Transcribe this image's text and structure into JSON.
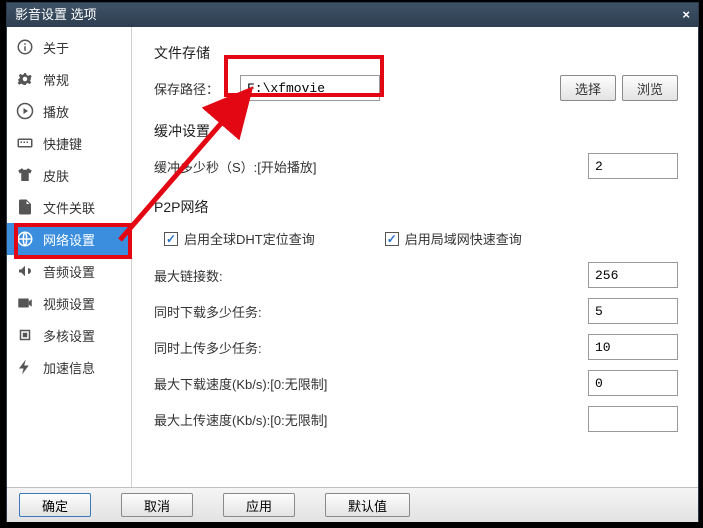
{
  "window": {
    "title": "影音设置 选项"
  },
  "sidebar": {
    "items": [
      {
        "label": "关于"
      },
      {
        "label": "常规"
      },
      {
        "label": "播放"
      },
      {
        "label": "快捷键"
      },
      {
        "label": "皮肤"
      },
      {
        "label": "文件关联"
      },
      {
        "label": "网络设置"
      },
      {
        "label": "音频设置"
      },
      {
        "label": "视频设置"
      },
      {
        "label": "多核设置"
      },
      {
        "label": "加速信息"
      }
    ],
    "selected_index": 6
  },
  "content": {
    "storage": {
      "title": "文件存储",
      "path_label": "保存路径：",
      "path_value": "F:\\xfmovie",
      "select_btn": "选择",
      "browse_btn": "浏览"
    },
    "buffer": {
      "title": "缓冲设置",
      "label": "缓冲多少秒（S）:[开始播放]",
      "value": "2"
    },
    "p2p": {
      "title": "P2P网络",
      "chk_dht": "启用全球DHT定位查询",
      "chk_lan": "启用局域网快速查询",
      "rows": [
        {
          "label": "最大链接数:",
          "value": "256"
        },
        {
          "label": "同时下载多少任务:",
          "value": "5"
        },
        {
          "label": "同时上传多少任务:",
          "value": "10"
        },
        {
          "label": "最大下载速度(Kb/s):[0:无限制]",
          "value": "0"
        },
        {
          "label": "最大上传速度(Kb/s):[0:无限制]",
          "value": ""
        }
      ]
    }
  },
  "footer": {
    "ok": "确定",
    "cancel": "取消",
    "apply": "应用",
    "default": "默认值"
  }
}
